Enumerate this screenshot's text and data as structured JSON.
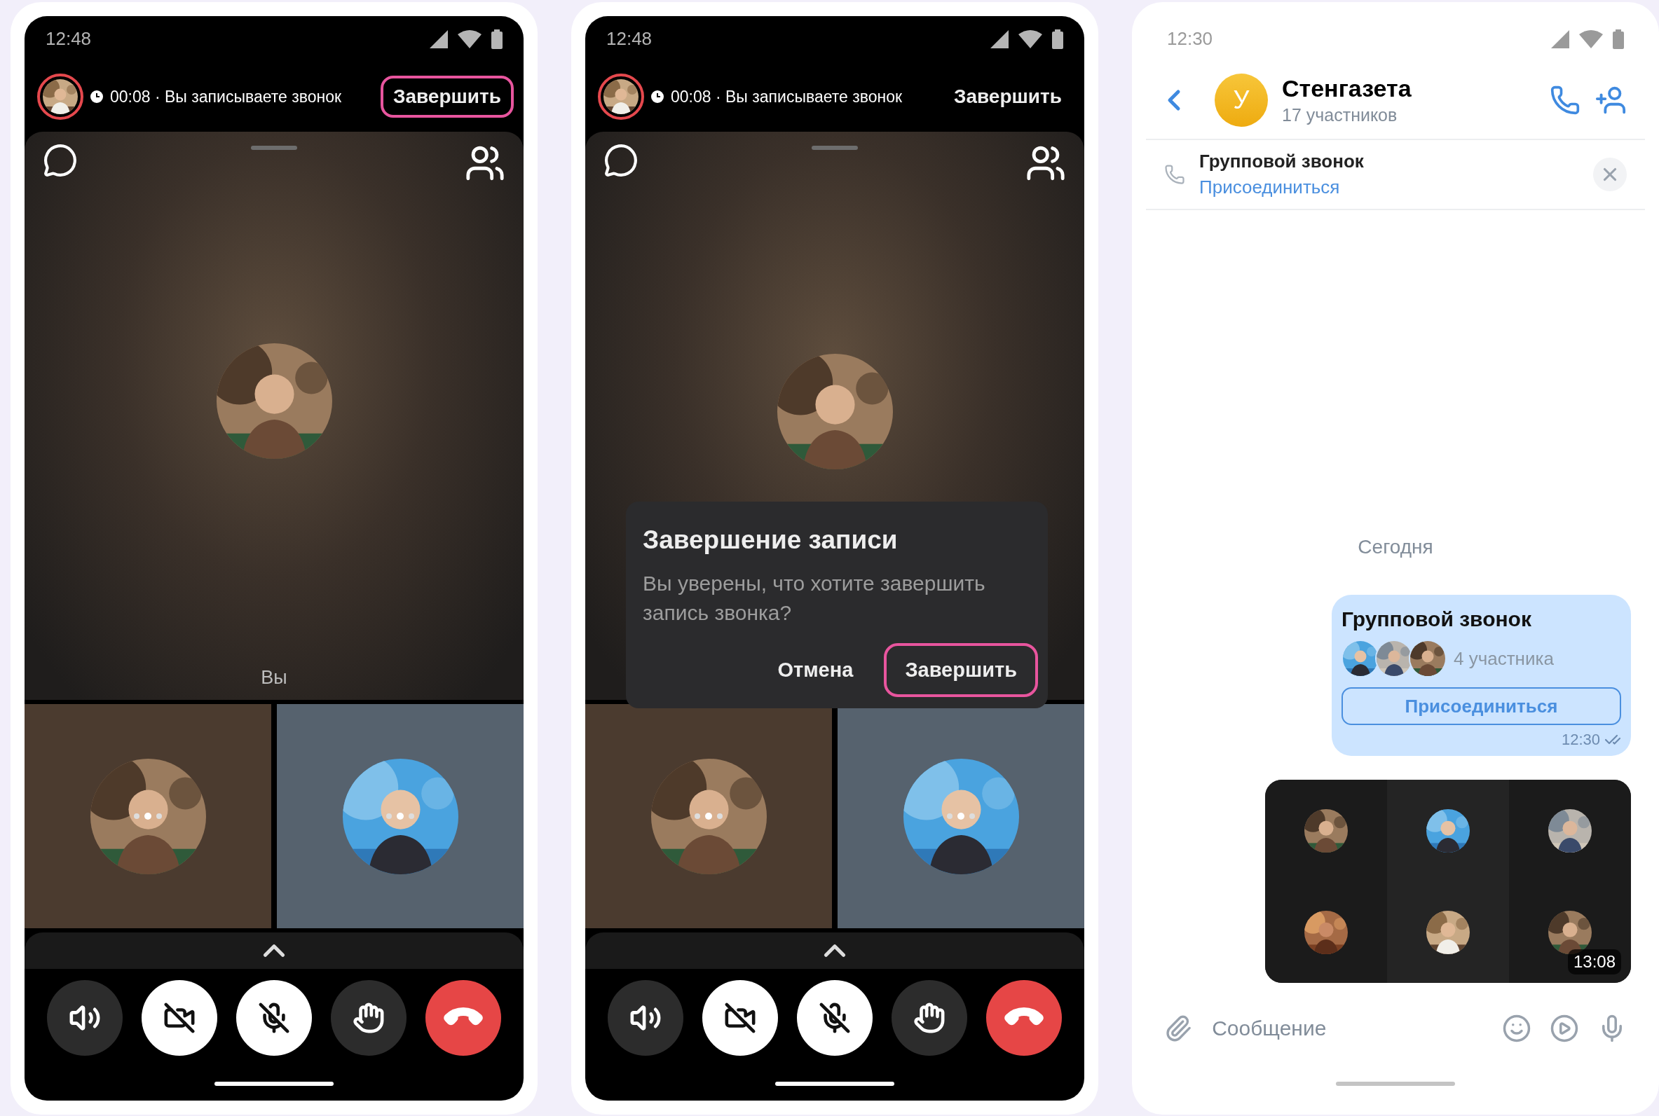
{
  "phones": [
    {
      "kind": "call",
      "status_time": "12:48",
      "call_bar": {
        "status": "00:08 · Вы записываете звонок",
        "end_button": {
          "label": "Завершить",
          "highlighted": true
        }
      },
      "main_tile": {
        "label": "Вы"
      },
      "side_tiles": [
        {
          "color": "#4b3b2f"
        },
        {
          "color": "#56626e"
        }
      ],
      "controls": [
        {
          "kind": "speaker",
          "active": false
        },
        {
          "kind": "camera",
          "active": true
        },
        {
          "kind": "mic",
          "active": true
        },
        {
          "kind": "hand",
          "active": false
        },
        {
          "kind": "hangup"
        }
      ]
    },
    {
      "kind": "call",
      "status_time": "12:48",
      "call_bar": {
        "status": "00:08 · Вы записываете звонок",
        "end_button": {
          "label": "Завершить",
          "highlighted": false
        }
      },
      "side_tiles": [
        {
          "color": "#4b3b2f"
        },
        {
          "color": "#56626e"
        }
      ],
      "controls": [
        {
          "kind": "speaker",
          "active": false
        },
        {
          "kind": "camera",
          "active": true
        },
        {
          "kind": "mic",
          "active": true
        },
        {
          "kind": "hand",
          "active": false
        },
        {
          "kind": "hangup"
        }
      ],
      "dialog": {
        "title": "Завершение записи",
        "message": "Вы уверены, что хотите завершить запись звонка?",
        "buttons": [
          {
            "label": "Отмена",
            "highlighted": false
          },
          {
            "label": "Завершить",
            "highlighted": true
          }
        ]
      }
    },
    {
      "kind": "chat",
      "status_time": "12:30",
      "header": {
        "avatar_letter": "У",
        "title": "Стенгазета",
        "subtitle": "17 участников"
      },
      "banner": {
        "title": "Групповой звонок",
        "link": "Присоединиться"
      },
      "date": "Сегодня",
      "call_message": {
        "title": "Групповой звонок",
        "participants": "4 участника",
        "join_button": "Присоединиться",
        "time": "12:30"
      },
      "video_message": {
        "duration": "13:08"
      },
      "composer": {
        "placeholder": "Сообщение"
      }
    }
  ]
}
